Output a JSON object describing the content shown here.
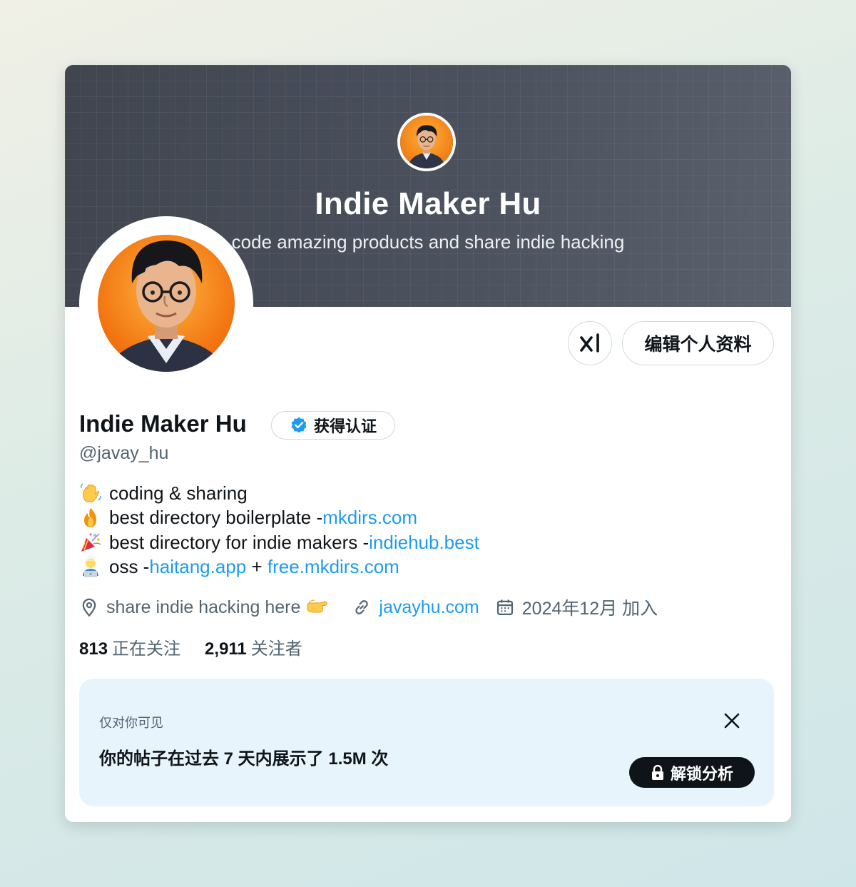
{
  "banner": {
    "title": "Indie Maker Hu",
    "subtitle": "code amazing products and share indie hacking"
  },
  "profile": {
    "name": "Indie Maker Hu",
    "verified_label": "获得认证",
    "handle": "@javay_hu",
    "edit_button_label": "编辑个人资料",
    "grok_icon": "grok-icon"
  },
  "bio": [
    {
      "emoji": "waving-hand",
      "text": "coding & sharing",
      "link": ""
    },
    {
      "emoji": "fire",
      "text": "best directory boilerplate - ",
      "link": "mkdirs.com"
    },
    {
      "emoji": "party-popper",
      "text": "best directory for indie makers - ",
      "link": "indiehub.best"
    },
    {
      "emoji": "technologist",
      "text": "oss - ",
      "link": "haitang.app",
      "separator": " + ",
      "link2": "free.mkdirs.com"
    }
  ],
  "meta": {
    "location": "share indie hacking here",
    "location_emoji": "pointing-right",
    "website": "javayhu.com",
    "joined": "2024年12月 加入"
  },
  "counts": {
    "following_num": "813",
    "following_label": "正在关注",
    "followers_num": "2,911",
    "followers_label": "关注者"
  },
  "notice": {
    "label": "仅对你可见",
    "text": "你的帖子在过去 7 天内展示了 1.5M 次",
    "button_label": "解锁分析"
  },
  "colors": {
    "link": "#1d9bf0",
    "verified": "#1d9bf0",
    "panel_bg": "#e8f4fc",
    "text": "#0f1419",
    "muted": "#536471"
  }
}
